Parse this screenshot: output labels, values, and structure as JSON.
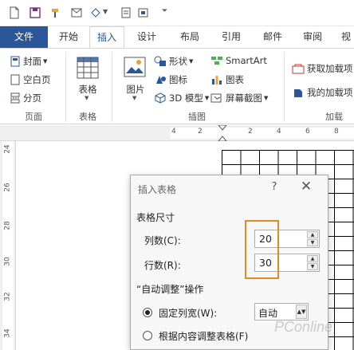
{
  "tabs": [
    {
      "label": "文件",
      "type": "file"
    },
    {
      "label": "开始"
    },
    {
      "label": "插入",
      "active": true
    },
    {
      "label": "设计"
    },
    {
      "label": "布局"
    },
    {
      "label": "引用"
    },
    {
      "label": "邮件"
    },
    {
      "label": "审阅"
    },
    {
      "label": "视"
    }
  ],
  "ribbon": {
    "pages": {
      "cover": "封面",
      "blank": "空白页",
      "break": "分页",
      "group": "页面"
    },
    "table": {
      "button": "表格",
      "group": "表格"
    },
    "illustrations": {
      "picture": "图片",
      "shapes": "形状",
      "icons": "图标",
      "model3d": "3D 模型",
      "smartart": "SmartArt",
      "chart": "图表",
      "screenshot": "屏幕截图",
      "group": "插图"
    },
    "addins": {
      "get": "获取加载项",
      "mine": "我的加载项",
      "group": "加载"
    }
  },
  "ruler": {
    "top_numbers": [
      "4",
      "2",
      "2",
      "4",
      "6",
      "8"
    ],
    "side_numbers": [
      "24",
      "26",
      "28",
      "30",
      "32",
      "34"
    ]
  },
  "dialog": {
    "title": "插入表格",
    "help": "?",
    "close": "✕",
    "size_section": "表格尺寸",
    "columns_label": "列数(C):",
    "columns_value": "20",
    "rows_label": "行数(R):",
    "rows_value": "30",
    "autofit_section": "“自动调整”操作",
    "fixed_width_label": "固定列宽(W):",
    "fixed_width_value": "自动",
    "autofit_content_label": "根据内容调整表格(F)"
  },
  "colors": {
    "accent": "#2b579a",
    "highlight": "#e28b1e"
  },
  "watermark": "PConline"
}
